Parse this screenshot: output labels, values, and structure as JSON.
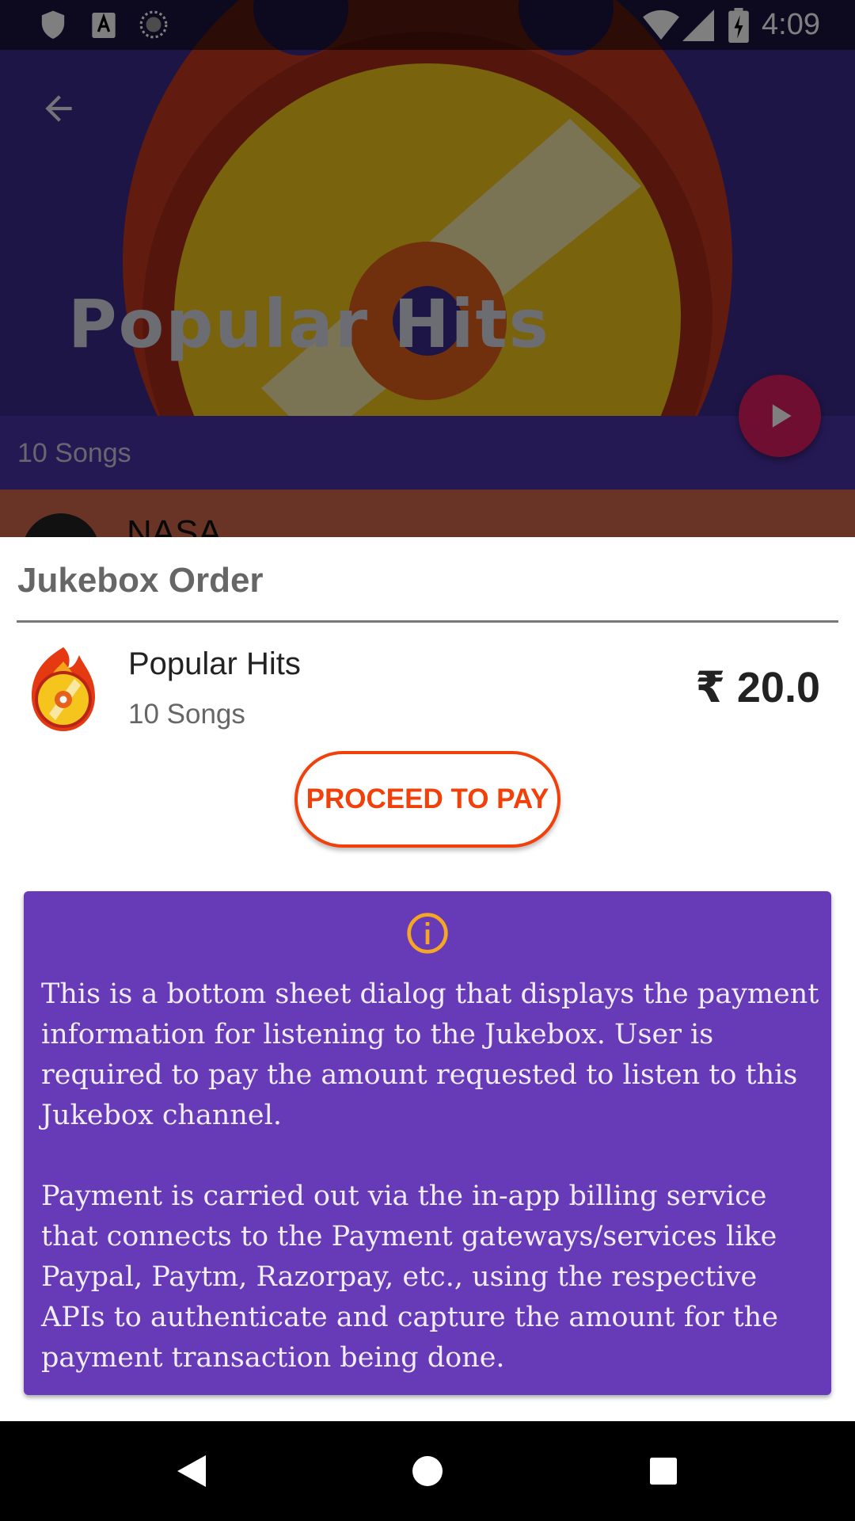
{
  "status_bar": {
    "time": "4:09",
    "icons": [
      "shield-icon",
      "keyboard-a-icon",
      "sync-icon",
      "wifi-icon",
      "signal-icon",
      "battery-charging-icon"
    ]
  },
  "background": {
    "hero_title": "Popular Hits",
    "songs_count": "10 Songs",
    "first_song_title": "NASA",
    "icons": [
      "back-arrow-icon",
      "play-icon"
    ]
  },
  "sheet": {
    "title": "Jukebox Order",
    "item_name": "Popular Hits",
    "item_songs": "10 Songs",
    "item_price": "₹ 20.0",
    "proceed_label": "PROCEED TO PAY",
    "info_text": "This is a bottom sheet dialog that displays the payment information for listening to the Jukebox. User is required to pay the amount requested to listen to this Jukebox channel.\n\nPayment is carried out via the in-app billing service that connects to the Payment gateways/services like Paypal, Paytm, Razorpay, etc., using the respective APIs to authenticate and capture the amount for the payment transaction being done."
  },
  "nav_bar": {
    "icons": [
      "nav-back-icon",
      "nav-home-icon",
      "nav-recents-icon"
    ]
  },
  "colors": {
    "accent": "#f2400a",
    "info_card": "#673ab7",
    "info_icon": "#f5a623",
    "hero_bg": "#3a2a8c",
    "fab": "#e11d62"
  }
}
